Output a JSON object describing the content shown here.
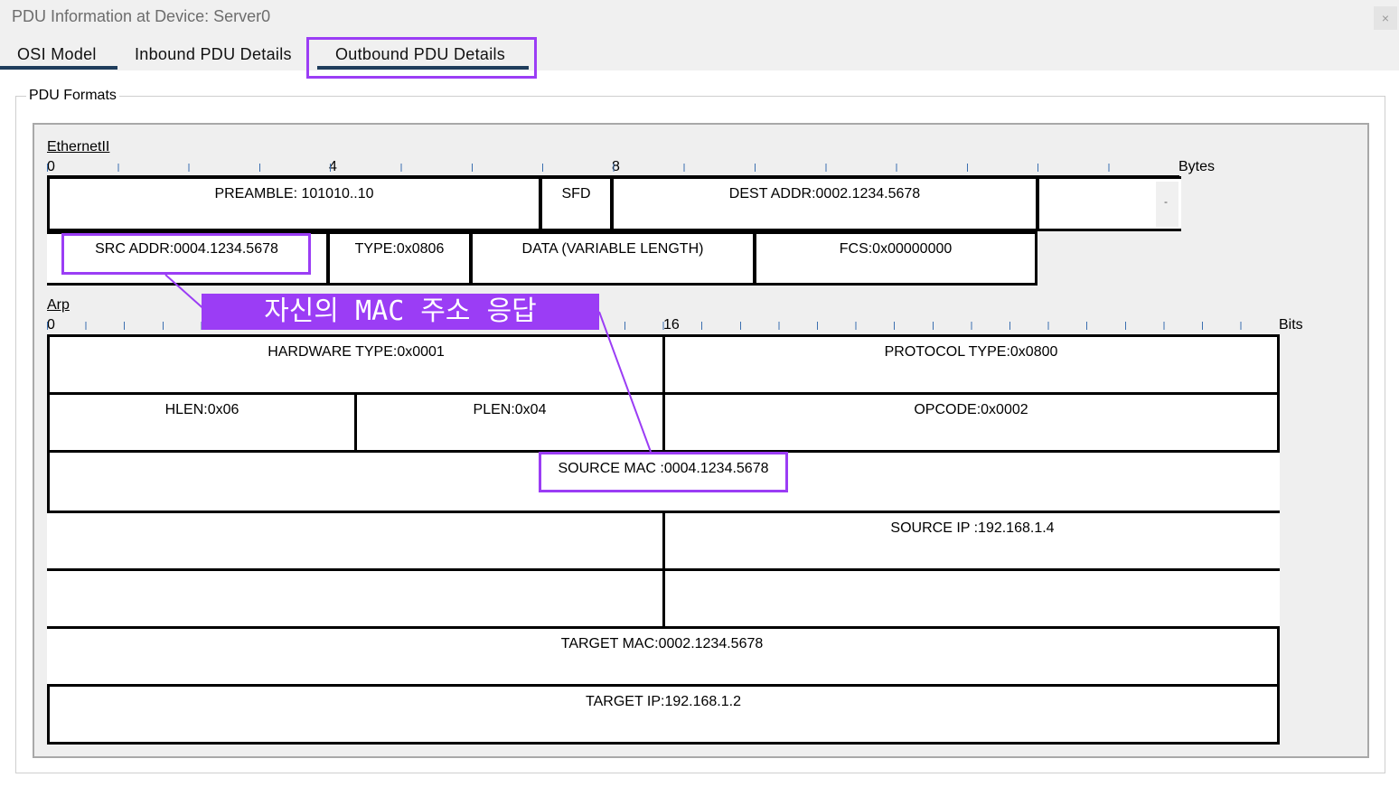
{
  "window": {
    "title": "PDU Information at Device: Server0",
    "close_glyph": "×"
  },
  "tabs": [
    {
      "label": "OSI Model"
    },
    {
      "label": "Inbound PDU Details"
    },
    {
      "label": "Outbound PDU Details"
    }
  ],
  "active_tab": "Outbound PDU Details",
  "group_label": "PDU Formats",
  "ethernet": {
    "name": "EthernetII",
    "scale": [
      "0",
      "4",
      "8"
    ],
    "unit": "Bytes",
    "fields": {
      "preamble": "PREAMBLE: 101010..10",
      "sfd": "SFD",
      "dest": "DEST ADDR:0002.1234.5678",
      "trail": "-",
      "src": "SRC ADDR:0004.1234.5678",
      "type": "TYPE:0x0806",
      "data": "DATA (VARIABLE LENGTH)",
      "fcs": "FCS:0x00000000"
    }
  },
  "arp": {
    "name": "Arp",
    "scale": [
      "0",
      "16"
    ],
    "unit": "Bits",
    "fields": {
      "hw_type": "HARDWARE TYPE:0x0001",
      "proto_type": "PROTOCOL TYPE:0x0800",
      "hlen": "HLEN:0x06",
      "plen": "PLEN:0x04",
      "opcode": "OPCODE:0x0002",
      "source_mac": "SOURCE MAC :0004.1234.5678",
      "source_ip": "SOURCE IP :192.168.1.4",
      "target_mac": "TARGET MAC:0002.1234.5678",
      "target_ip": "TARGET IP:192.168.1.2"
    }
  },
  "annotation": {
    "text": "자신의 MAC 주소 응답",
    "color": "#9b3df5"
  }
}
